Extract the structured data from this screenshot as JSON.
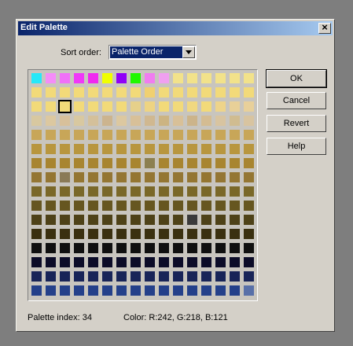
{
  "dialog": {
    "title": "Edit Palette"
  },
  "sort": {
    "label": "Sort order:",
    "value": "Palette Order"
  },
  "buttons": {
    "ok": "OK",
    "cancel": "Cancel",
    "revert": "Revert",
    "help": "Help"
  },
  "status": {
    "palette_index": "Palette index:  34",
    "color": "Color:  R:242, G:218, B:121"
  },
  "palette": {
    "selected_index": 34,
    "rows": [
      [
        "#28e8f8",
        "#f48cf8",
        "#f070f8",
        "#f038f8",
        "#f028f0",
        "#f0ff00",
        "#9000f8",
        "#20f800",
        "#f07cf0",
        "#f0a0f0",
        "#f2e28a",
        "#f2e28a",
        "#f2e28a",
        "#f2e28a",
        "#f2e28a",
        "#f2e28a"
      ],
      [
        "#f2da79",
        "#f2da79",
        "#f2da79",
        "#f2da79",
        "#f2da79",
        "#f2da79",
        "#f2da79",
        "#f2da79",
        "#f0d070",
        "#f2da79",
        "#f2da79",
        "#f2da79",
        "#f2da79",
        "#f2da79",
        "#f2da79",
        "#f2da79"
      ],
      [
        "#f2da79",
        "#f2da79",
        "#f2da79",
        "#f2da79",
        "#f2da79",
        "#f2da79",
        "#f2da79",
        "#e6d08a",
        "#eed482",
        "#f2da79",
        "#f2da79",
        "#f0d880",
        "#f2da79",
        "#eed48a",
        "#e8d098",
        "#e8d09a"
      ],
      [
        "#d8c8a0",
        "#dcc8a0",
        "#d8c09a",
        "#d8c8a0",
        "#d4c09a",
        "#ccb48e",
        "#dcc8a0",
        "#d8c098",
        "#d0b890",
        "#ccb482",
        "#d8c098",
        "#ccb48a",
        "#d4bc92",
        "#d8c4a0",
        "#d0bc90",
        "#d8c4a0"
      ],
      [
        "#c8a658",
        "#c8a658",
        "#c8a658",
        "#c8a658",
        "#c8a658",
        "#c8a658",
        "#c8a658",
        "#c8a658",
        "#c8a658",
        "#c8a658",
        "#c8a658",
        "#c8a658",
        "#c8a658",
        "#c8a658",
        "#c8a658",
        "#c8a658"
      ],
      [
        "#b8963e",
        "#b8963e",
        "#b8963e",
        "#b8963e",
        "#b8963e",
        "#b8963e",
        "#b8963e",
        "#b8963e",
        "#b8963e",
        "#b8963e",
        "#b8963e",
        "#b8963e",
        "#b8963e",
        "#b8963e",
        "#b8963e",
        "#b8963e"
      ],
      [
        "#a88530",
        "#a88530",
        "#a88530",
        "#a88530",
        "#a88530",
        "#a88530",
        "#a88530",
        "#a88530",
        "#8c8050",
        "#a88530",
        "#a88530",
        "#a88530",
        "#a88530",
        "#a88530",
        "#a88530",
        "#a88530"
      ],
      [
        "#947632",
        "#947632",
        "#8a7a56",
        "#947632",
        "#947632",
        "#947632",
        "#947632",
        "#947632",
        "#947632",
        "#947632",
        "#947632",
        "#947632",
        "#947632",
        "#947632",
        "#947632",
        "#947632"
      ],
      [
        "#7a6828",
        "#7a6828",
        "#7a6828",
        "#7a6828",
        "#7a6828",
        "#7a6828",
        "#7a6828",
        "#7a6828",
        "#7a6828",
        "#7a6828",
        "#7a6828",
        "#7a6828",
        "#7a6828",
        "#7a6828",
        "#7a6828",
        "#7a6828"
      ],
      [
        "#665620",
        "#665620",
        "#665620",
        "#665620",
        "#665620",
        "#665620",
        "#665620",
        "#665620",
        "#665620",
        "#665620",
        "#665620",
        "#665620",
        "#665620",
        "#665620",
        "#665620",
        "#665620"
      ],
      [
        "#4e4218",
        "#4e4218",
        "#4e4218",
        "#4e4218",
        "#4e4218",
        "#4e4218",
        "#4e4218",
        "#4e4218",
        "#4e4218",
        "#4e4218",
        "#4e4218",
        "#3a3a3a",
        "#4e4218",
        "#4e4218",
        "#4e4218",
        "#4e4218"
      ],
      [
        "#3a3010",
        "#3a3010",
        "#3a3010",
        "#3a3010",
        "#3a3010",
        "#3a3010",
        "#3a3010",
        "#3a3010",
        "#3a3010",
        "#3a3010",
        "#3a3010",
        "#3a3010",
        "#3a3010",
        "#3a3010",
        "#3a3010",
        "#3a3010"
      ],
      [
        "#101010",
        "#101010",
        "#101010",
        "#101010",
        "#101010",
        "#101010",
        "#101010",
        "#101010",
        "#101010",
        "#101010",
        "#101010",
        "#101010",
        "#101010",
        "#101010",
        "#101010",
        "#101010"
      ],
      [
        "#0c0c28",
        "#0c0c28",
        "#0c0c28",
        "#0c0c28",
        "#0c0c28",
        "#0c0c28",
        "#0c0c28",
        "#0c0c28",
        "#0c0c28",
        "#0c0c28",
        "#0c0c28",
        "#0c0c28",
        "#0c0c28",
        "#0c0c28",
        "#0c0c28",
        "#0c0c28"
      ],
      [
        "#182458",
        "#182458",
        "#182458",
        "#182458",
        "#182458",
        "#182458",
        "#182458",
        "#182458",
        "#182458",
        "#182458",
        "#182458",
        "#182458",
        "#182458",
        "#182458",
        "#182458",
        "#182458"
      ],
      [
        "#24408a",
        "#24408a",
        "#24408a",
        "#24408a",
        "#24408a",
        "#24408a",
        "#24408a",
        "#24408a",
        "#24408a",
        "#24408a",
        "#24408a",
        "#24408a",
        "#24408a",
        "#24408a",
        "#24408a",
        "#5870a8"
      ]
    ]
  }
}
